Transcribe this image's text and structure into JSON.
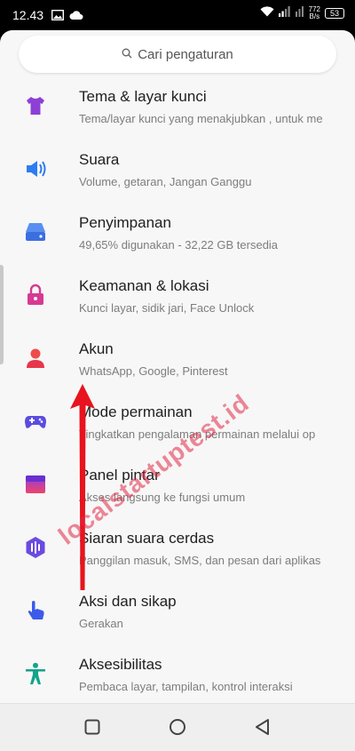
{
  "status_bar": {
    "time": "12.43",
    "net_speed_value": "772",
    "net_speed_unit": "B/s",
    "battery": "53"
  },
  "search": {
    "placeholder": "Cari pengaturan",
    "icon": "search-icon"
  },
  "settings": [
    {
      "title": "Tema & layar kunci",
      "subtitle": "Tema/layar kunci yang menakjubkan , untuk me",
      "icon": "theme-shirt-icon",
      "color": "#8e3fd6"
    },
    {
      "title": "Suara",
      "subtitle": "Volume, getaran, Jangan Ganggu",
      "icon": "speaker-icon",
      "color": "#2d7df0"
    },
    {
      "title": "Penyimpanan",
      "subtitle": "49,65% digunakan - 32,22 GB tersedia",
      "icon": "storage-icon",
      "color": "#3b6fe0"
    },
    {
      "title": "Keamanan & lokasi",
      "subtitle": "Kunci layar, sidik jari, Face Unlock",
      "icon": "lock-icon",
      "color": "#d63a93"
    },
    {
      "title": "Akun",
      "subtitle": "WhatsApp, Google, Pinterest",
      "icon": "account-icon",
      "color": "#f04a4a"
    },
    {
      "title": "Mode permainan",
      "subtitle": "Tingkatkan pengalaman permainan melalui op",
      "icon": "gamepad-icon",
      "color": "#5b4ce0"
    },
    {
      "title": "Panel pintar",
      "subtitle": "Akses langsung ke fungsi umum",
      "icon": "smart-panel-icon",
      "color": "#e8436f"
    },
    {
      "title": "Siaran suara cerdas",
      "subtitle": "Panggilan masuk, SMS, dan pesan dari aplikas",
      "icon": "smart-broadcast-icon",
      "color": "#6a4be0"
    },
    {
      "title": "Aksi dan sikap",
      "subtitle": "Gerakan",
      "icon": "gesture-hand-icon",
      "color": "#3c5be8"
    },
    {
      "title": "Aksesibilitas",
      "subtitle": "Pembaca layar, tampilan, kontrol interaksi",
      "icon": "accessibility-icon",
      "color": "#12a38a"
    }
  ],
  "overlay": {
    "watermark": "localstartuptest.id",
    "arrow_color": "#e8131e"
  }
}
